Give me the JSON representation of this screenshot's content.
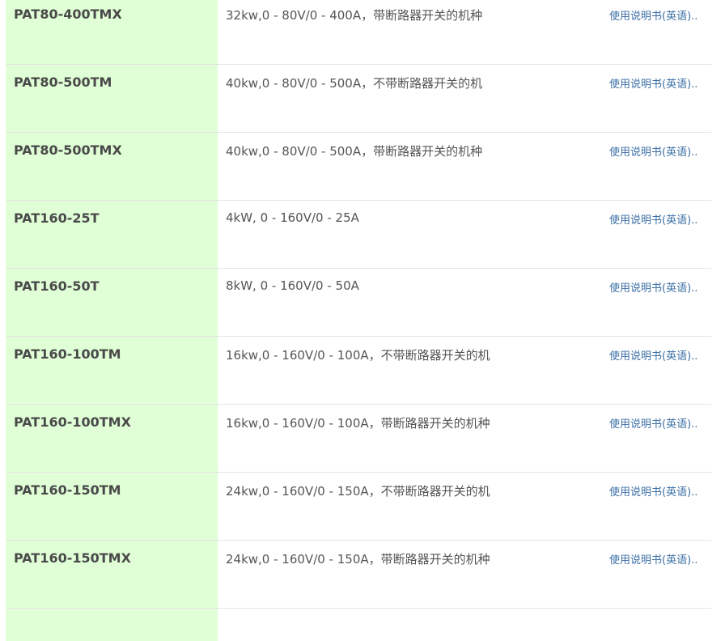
{
  "link_label": "使用说明书(英语)..",
  "rows": [
    {
      "model": "PAT80-400TMX",
      "desc": "32kw,0 - 80V/0 - 400A，带断路器开关的机种"
    },
    {
      "model": "PAT80-500TM",
      "desc": "40kw,0 - 80V/0 - 500A，不带断路器开关的机"
    },
    {
      "model": "PAT80-500TMX",
      "desc": "40kw,0 - 80V/0 - 500A，带断路器开关的机种"
    },
    {
      "model": "PAT160-25T",
      "desc": "4kW, 0 - 160V/0 - 25A"
    },
    {
      "model": "PAT160-50T",
      "desc": "8kW, 0 - 160V/0 - 50A"
    },
    {
      "model": "PAT160-100TM",
      "desc": "16kw,0 - 160V/0 - 100A，不带断路器开关的机"
    },
    {
      "model": "PAT160-100TMX",
      "desc": "16kw,0 - 160V/0 - 100A，带断路器开关的机种"
    },
    {
      "model": "PAT160-150TM",
      "desc": "24kw,0 - 160V/0 - 150A，不带断路器开关的机"
    },
    {
      "model": "PAT160-150TMX",
      "desc": "24kw,0 - 160V/0 - 150A，带断路器开关的机种"
    }
  ]
}
